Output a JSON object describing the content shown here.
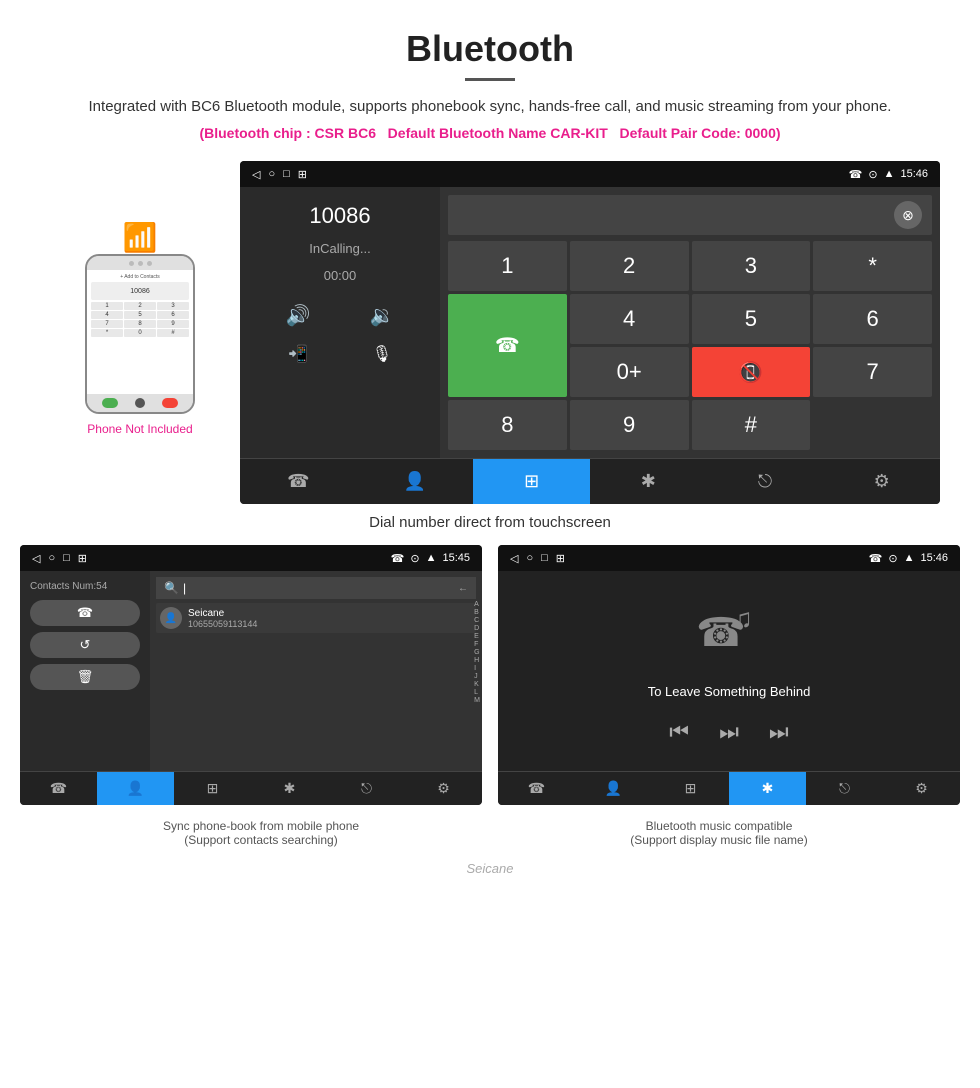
{
  "header": {
    "title": "Bluetooth",
    "description": "Integrated with BC6 Bluetooth module, supports phonebook sync, hands-free call, and music streaming from your phone.",
    "chip_info": "(Bluetooth chip : CSR BC6",
    "name_info": "Default Bluetooth Name CAR-KIT",
    "pair_info": "Default Pair Code: 0000)"
  },
  "phone_section": {
    "not_included": "Phone Not Included"
  },
  "dial_screen": {
    "status_bar": {
      "left_icons": [
        "◁",
        "○",
        "□",
        "⊞"
      ],
      "right": "☎ ⊙ ▲ 15:46"
    },
    "number": "10086",
    "calling": "InCalling...",
    "time": "00:00",
    "numpad_keys": [
      "1",
      "2",
      "3",
      "*",
      "4",
      "5",
      "6",
      "0+",
      "7",
      "8",
      "9",
      "#"
    ],
    "tabs": [
      "☎↗",
      "👤",
      "⊞",
      "✱",
      "⎋",
      "⚙"
    ]
  },
  "caption_main": "Dial number direct from touchscreen",
  "contacts_screen": {
    "contacts_num": "Contacts Num:54",
    "buttons": [
      "☎",
      "↺",
      "🗑"
    ],
    "contact_name": "Seicane",
    "contact_phone": "10655059113144",
    "alphabet": [
      "A",
      "B",
      "C",
      "D",
      "E",
      "F",
      "G",
      "H",
      "I",
      "J",
      "K",
      "L",
      "M"
    ]
  },
  "music_screen": {
    "song_title": "To Leave Something Behind"
  },
  "bottom_captions": {
    "left": "Sync phone-book from mobile phone",
    "left_sub": "(Support contacts searching)",
    "right": "Bluetooth music compatible",
    "right_sub": "(Support display music file name)"
  },
  "watermark": "Seicane"
}
